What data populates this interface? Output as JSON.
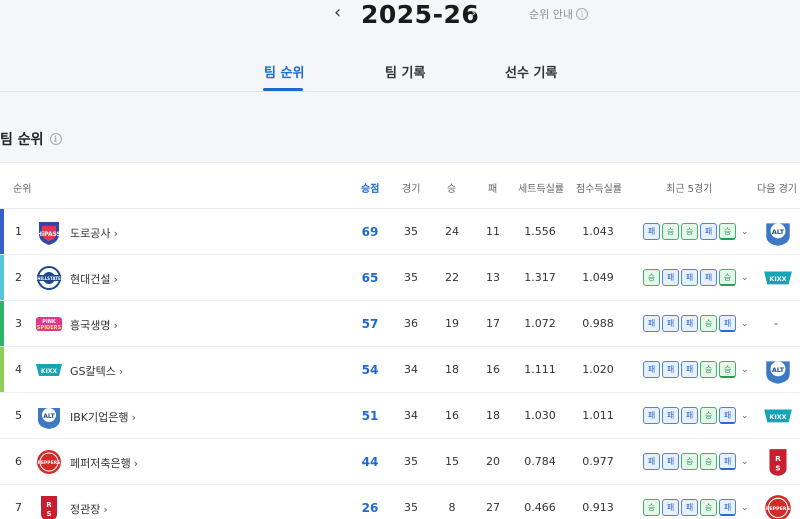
{
  "season": {
    "prev": "‹",
    "title": "2025-26",
    "next": "›",
    "guide": "순위 안내"
  },
  "tabs": [
    {
      "label": "팀 순위",
      "active": true
    },
    {
      "label": "팀 기록",
      "active": false
    },
    {
      "label": "선수 기록",
      "active": false
    }
  ],
  "section_title": "팀 순위",
  "headers": {
    "rank": "순위",
    "points": "승점",
    "games": "경기",
    "wins": "승",
    "losses": "패",
    "set_ratio": "세트득실률",
    "score_ratio": "점수득실률",
    "recent": "최근 5경기",
    "next": "다음 경기"
  },
  "result_labels": {
    "W": "승",
    "L": "패"
  },
  "colors": {
    "accent": "#1f68d0",
    "win": "#2a9c56",
    "loss": "#2d6ad2"
  },
  "rows": [
    {
      "rank": "1",
      "team": "도로공사",
      "points": "69",
      "games": "35",
      "wins": "24",
      "losses": "11",
      "set_ratio": "1.556",
      "score_ratio": "1.043",
      "recent": [
        "L",
        "W",
        "W",
        "L",
        "W"
      ],
      "bar": "#3b5fc9",
      "logo": "ex",
      "next": "ibk"
    },
    {
      "rank": "2",
      "team": "현대건설",
      "points": "65",
      "games": "35",
      "wins": "22",
      "losses": "13",
      "set_ratio": "1.317",
      "score_ratio": "1.049",
      "recent": [
        "W",
        "L",
        "L",
        "L",
        "W"
      ],
      "bar": "#55c7d6",
      "logo": "hd",
      "next": "gs"
    },
    {
      "rank": "3",
      "team": "흥국생명",
      "points": "57",
      "games": "36",
      "wins": "19",
      "losses": "17",
      "set_ratio": "1.072",
      "score_ratio": "0.988",
      "recent": [
        "L",
        "L",
        "L",
        "W",
        "L"
      ],
      "bar": "#2db56b",
      "logo": "pink",
      "next": "-"
    },
    {
      "rank": "4",
      "team": "GS칼텍스",
      "points": "54",
      "games": "34",
      "wins": "18",
      "losses": "16",
      "set_ratio": "1.111",
      "score_ratio": "1.020",
      "recent": [
        "L",
        "L",
        "L",
        "W",
        "W"
      ],
      "bar": "#8fd156",
      "logo": "gs",
      "next": "ibk"
    },
    {
      "rank": "5",
      "team": "IBK기업은행",
      "points": "51",
      "games": "34",
      "wins": "16",
      "losses": "18",
      "set_ratio": "1.030",
      "score_ratio": "1.011",
      "recent": [
        "L",
        "L",
        "L",
        "W",
        "L"
      ],
      "bar": "",
      "logo": "ibk",
      "next": "gs"
    },
    {
      "rank": "6",
      "team": "페퍼저축은행",
      "points": "44",
      "games": "35",
      "wins": "15",
      "losses": "20",
      "set_ratio": "0.784",
      "score_ratio": "0.977",
      "recent": [
        "L",
        "L",
        "W",
        "W",
        "L"
      ],
      "bar": "",
      "logo": "pepper",
      "next": "kgc"
    },
    {
      "rank": "7",
      "team": "정관장",
      "points": "26",
      "games": "35",
      "wins": "8",
      "losses": "27",
      "set_ratio": "0.466",
      "score_ratio": "0.913",
      "recent": [
        "W",
        "L",
        "L",
        "W",
        "L"
      ],
      "bar": "",
      "logo": "kgc",
      "next": "pepper"
    }
  ]
}
